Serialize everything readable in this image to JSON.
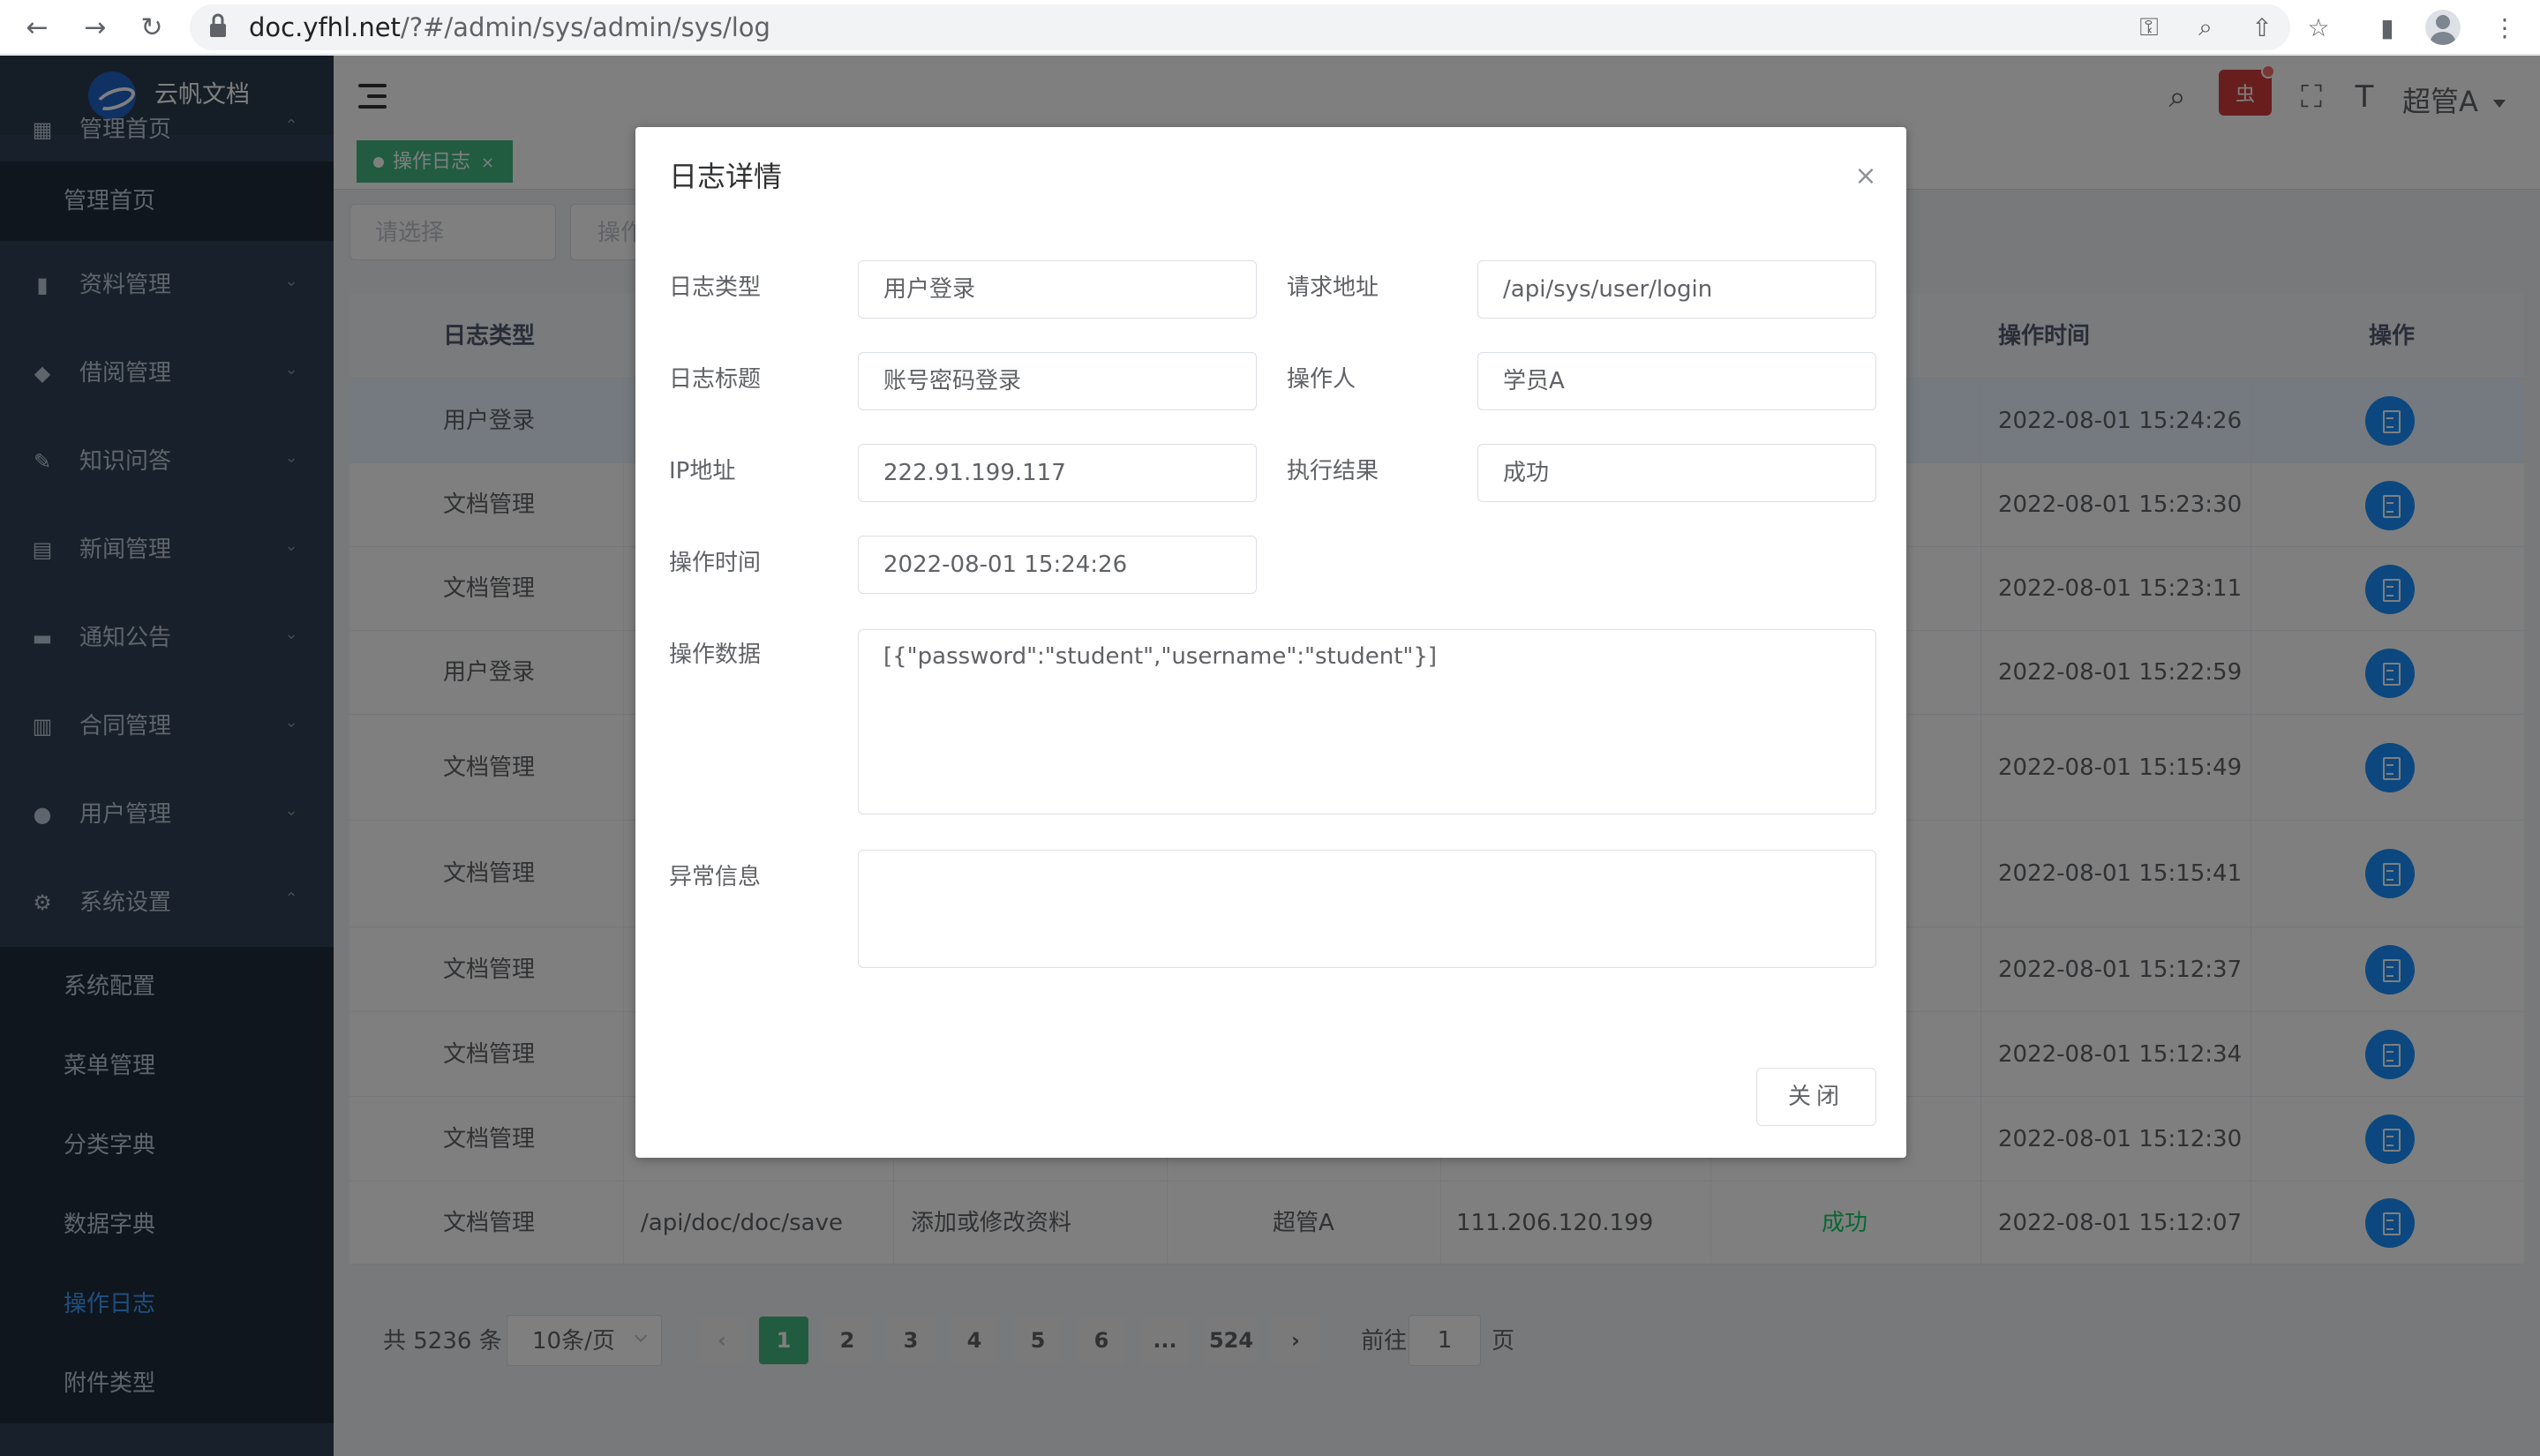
{
  "browser": {
    "url_host": "doc.yfhl.net",
    "url_path": "/?#/admin/sys/admin/sys/log"
  },
  "sidebar": {
    "logo_text": "云帆文档",
    "menu": [
      {
        "label": "管理首页",
        "icon": "grid-icon"
      },
      {
        "label": "资料管理",
        "icon": "book-icon"
      },
      {
        "label": "借阅管理",
        "icon": "box-icon"
      },
      {
        "label": "知识问答",
        "icon": "edit-icon"
      },
      {
        "label": "新闻管理",
        "icon": "news-icon"
      },
      {
        "label": "通知公告",
        "icon": "chat-icon"
      },
      {
        "label": "合同管理",
        "icon": "contract-icon"
      },
      {
        "label": "用户管理",
        "icon": "user-icon"
      },
      {
        "label": "系统设置",
        "icon": "gear-icon"
      }
    ],
    "home_sub": "管理首页",
    "sys_sub": [
      "系统配置",
      "菜单管理",
      "分类字典",
      "数据字典",
      "操作日志",
      "附件类型"
    ]
  },
  "header": {
    "user_name": "超管A",
    "bug_label": "虫"
  },
  "tags": {
    "active_tag": "操作日志"
  },
  "search": {
    "select_placeholder": "请选择",
    "input_placeholder": "操作"
  },
  "table": {
    "headers": {
      "type": "日志类型",
      "time": "操作时间",
      "ops": "操作"
    },
    "rows": [
      {
        "type": "用户登录",
        "time": "2022-08-01 15:24:26"
      },
      {
        "type": "文档管理",
        "time": "2022-08-01 15:23:30"
      },
      {
        "type": "文档管理",
        "time": "2022-08-01 15:23:11"
      },
      {
        "type": "用户登录",
        "time": "2022-08-01 15:22:59"
      },
      {
        "type": "文档管理",
        "time": "2022-08-01 15:15:49"
      },
      {
        "type": "文档管理",
        "time": "2022-08-01 15:15:41"
      },
      {
        "type": "文档管理",
        "time": "2022-08-01 15:12:37"
      },
      {
        "type": "文档管理",
        "time": "2022-08-01 15:12:34"
      },
      {
        "type": "文档管理",
        "time": "2022-08-01 15:12:30"
      }
    ],
    "last_row": {
      "type": "文档管理",
      "url": "/api/doc/doc/save",
      "title": "添加或修改资料",
      "user": "超管A",
      "ip": "111.206.120.199",
      "result": "成功",
      "time": "2022-08-01 15:12:07"
    }
  },
  "pagination": {
    "total": "共 5236 条",
    "page_size": "10条/页",
    "pages": [
      "1",
      "2",
      "3",
      "4",
      "5",
      "6",
      "...",
      "524"
    ],
    "current_page": 1,
    "goto_label": "前往",
    "goto_value": "1",
    "page_suffix": "页",
    "prev": "‹",
    "next": "›"
  },
  "dialog": {
    "title": "日志详情",
    "close_icon": "×",
    "fields": {
      "log_type_label": "日志类型",
      "log_type_value": "用户登录",
      "request_url_label": "请求地址",
      "request_url_value": "/api/sys/user/login",
      "log_title_label": "日志标题",
      "log_title_value": "账号密码登录",
      "operator_label": "操作人",
      "operator_value": "学员A",
      "ip_label": "IP地址",
      "ip_value": "222.91.199.117",
      "result_label": "执行结果",
      "result_value": "成功",
      "time_label": "操作时间",
      "time_value": "2022-08-01 15:24:26",
      "data_label": "操作数据",
      "data_value": "[{\"password\":\"student\",\"username\":\"student\"}]",
      "error_label": "异常信息",
      "error_value": ""
    },
    "close_button": "关闭"
  },
  "colors": {
    "sidebar_bg": "#304156",
    "accent_green": "#42b983",
    "op_blue": "#1890ff",
    "success_green": "#13ce66",
    "active_menu": "#409eff"
  }
}
